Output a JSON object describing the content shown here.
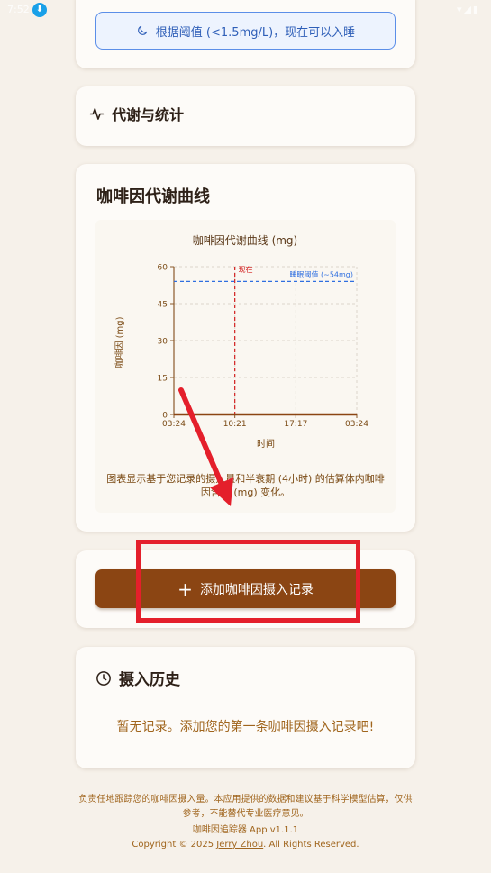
{
  "status_bar": {
    "time": "7:52",
    "right": "▾◢▮"
  },
  "sleep_notice": {
    "text": "根据阈值 (<1.5mg/L)，现在可以入睡"
  },
  "metabolism": {
    "title": "代谢与统计"
  },
  "chart_card": {
    "title": "咖啡因代谢曲线",
    "caption": "图表显示基于您记录的摄入量和半衰期 (4小时) 的估算体内咖啡因含量 (mg) 变化。"
  },
  "chart_data": {
    "type": "line",
    "title": "咖啡因代谢曲线 (mg)",
    "xlabel": "时间",
    "ylabel": "咖啡因 (mg)",
    "x_ticks": [
      "03:24",
      "10:21",
      "17:17",
      "03:24"
    ],
    "y_ticks": [
      0,
      15,
      30,
      45,
      60
    ],
    "ylim": [
      0,
      60
    ],
    "series": [
      {
        "values": [
          0,
          0,
          0,
          0
        ]
      }
    ],
    "threshold": {
      "label": "睡眠阈值 (~54mg)",
      "value": 54
    },
    "now_marker": {
      "label": "现在",
      "x": "10:21"
    },
    "grid": true,
    "colors": {
      "line": "#8b4513",
      "threshold": "#2f6fe0",
      "now": "#d32020"
    }
  },
  "add_button": {
    "label": "添加咖啡因摄入记录"
  },
  "history": {
    "title": "摄入历史",
    "empty_text": "暂无记录。添加您的第一条咖啡因摄入记录吧!"
  },
  "footer": {
    "disclaimer": "负责任地跟踪您的咖啡因摄入量。本应用提供的数据和建议基于科学模型估算，仅供参考，不能替代专业医疗意见。",
    "version": "咖啡因追踪器 App v1.1.1",
    "copyright_prefix": "Copyright © 2025 ",
    "author": "Jerry Zhou",
    "copyright_suffix": ". All Rights Reserved."
  },
  "colors": {
    "background": "#f6f1ea",
    "accent_brown": "#8b4513",
    "notice_blue": "#2f5fb8",
    "annotation_red": "#e41f2b"
  }
}
